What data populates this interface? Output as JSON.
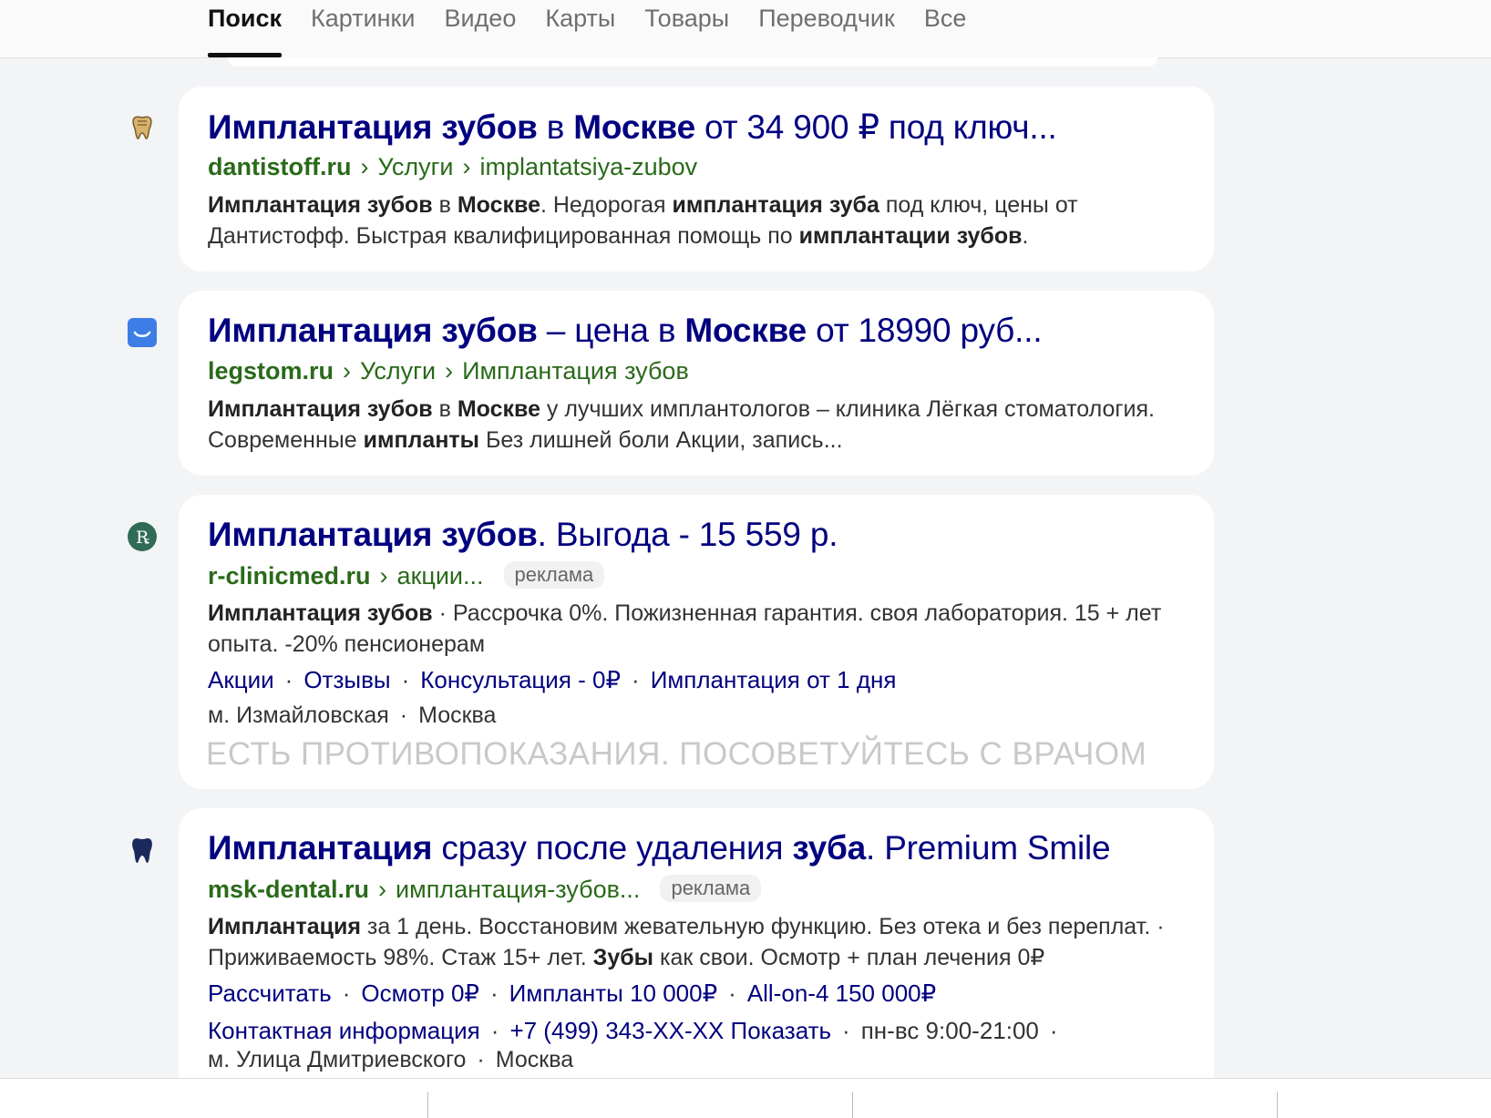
{
  "tabs": [
    {
      "label": "Поиск"
    },
    {
      "label": "Картинки"
    },
    {
      "label": "Видео"
    },
    {
      "label": "Карты"
    },
    {
      "label": "Товары"
    },
    {
      "label": "Переводчик"
    },
    {
      "label": "Все"
    }
  ],
  "results": [
    {
      "icon": "tooth-gold-icon",
      "title": [
        [
          "Имплантация зубов",
          true
        ],
        [
          " в ",
          false
        ],
        [
          "Москве",
          true
        ],
        [
          " от 34 900 ₽ под ключ...",
          false
        ]
      ],
      "domain": "dantistoff.ru",
      "crumbs": [
        "Услуги",
        "implantatsiya-zubov"
      ],
      "snippet": [
        [
          "Имплантация зубов",
          true
        ],
        [
          " в ",
          false
        ],
        [
          "Москве",
          true
        ],
        [
          ". Недорогая ",
          false
        ],
        [
          "имплантация зуба",
          true
        ],
        [
          " под ключ, цены от Дантистофф. Быстрая квалифицированная помощь по ",
          false
        ],
        [
          "имплантации зубов",
          true
        ],
        [
          ".",
          false
        ]
      ]
    },
    {
      "icon": "smile-logo-icon",
      "title": [
        [
          "Имплантация зубов",
          true
        ],
        [
          " – цена в ",
          false
        ],
        [
          "Москве",
          true
        ],
        [
          " от 18990 руб...",
          false
        ]
      ],
      "domain": "legstom.ru",
      "crumbs": [
        "Услуги",
        "Имплантация зубов"
      ],
      "snippet": [
        [
          "Имплантация зубов",
          true
        ],
        [
          " в ",
          false
        ],
        [
          "Москве",
          true
        ],
        [
          " у лучших имплантологов – клиника Лёгкая стоматология. Современные ",
          false
        ],
        [
          "импланты",
          true
        ],
        [
          " Без лишней боли Акции, запись...",
          false
        ]
      ]
    },
    {
      "icon": "r-clinic-logo-icon",
      "title": [
        [
          "Имплантация зубов",
          true
        ],
        [
          ". Выгода - 15 559 р.",
          false
        ]
      ],
      "domain": "r-clinicmed.ru",
      "crumbs": [
        "акции..."
      ],
      "ad": "реклама",
      "snippet": [
        [
          "Имплантация зубов",
          true
        ],
        [
          " · Рассрочка 0%. Пожизненная гарантия. своя лаборатория. 15 + лет опыта. -20% пенсионерам",
          false
        ]
      ],
      "links": [
        "Акции",
        "Отзывы",
        "Консультация - 0₽",
        "Имплантация от 1 дня"
      ],
      "meta": [
        "м. Измайловская",
        "Москва"
      ],
      "warning": "ЕСТЬ ПРОТИВОПОКАЗАНИЯ. ПОСОВЕТУЙТЕСЬ С ВРАЧОМ"
    },
    {
      "icon": "tooth-navy-icon",
      "title": [
        [
          "Имплантация",
          true
        ],
        [
          " сразу после удаления ",
          false
        ],
        [
          "зуба",
          true
        ],
        [
          ". Premium Smile",
          false
        ]
      ],
      "domain": "msk-dental.ru",
      "crumbs": [
        "имплантация-зубов..."
      ],
      "ad": "реклама",
      "snippet": [
        [
          "Имплантация",
          true
        ],
        [
          " за 1 день. Восстановим жевательную функцию. Без отека и без переплат. · Приживаемость 98%. Стаж 15+ лет. ",
          false
        ],
        [
          "Зубы",
          true
        ],
        [
          " как свои. Осмотр + план лечения 0₽",
          false
        ]
      ],
      "links": [
        "Рассчитать",
        "Осмотр 0₽",
        "Импланты 10 000₽",
        "All-on-4 150 000₽"
      ],
      "contact": {
        "label": "Контактная информация",
        "phone": "+7 (499) 343-XX-XX Показать",
        "hours": "пн-вс 9:00-21:00"
      },
      "meta": [
        "м. Улица Дмитриевского",
        "Москва"
      ]
    }
  ]
}
